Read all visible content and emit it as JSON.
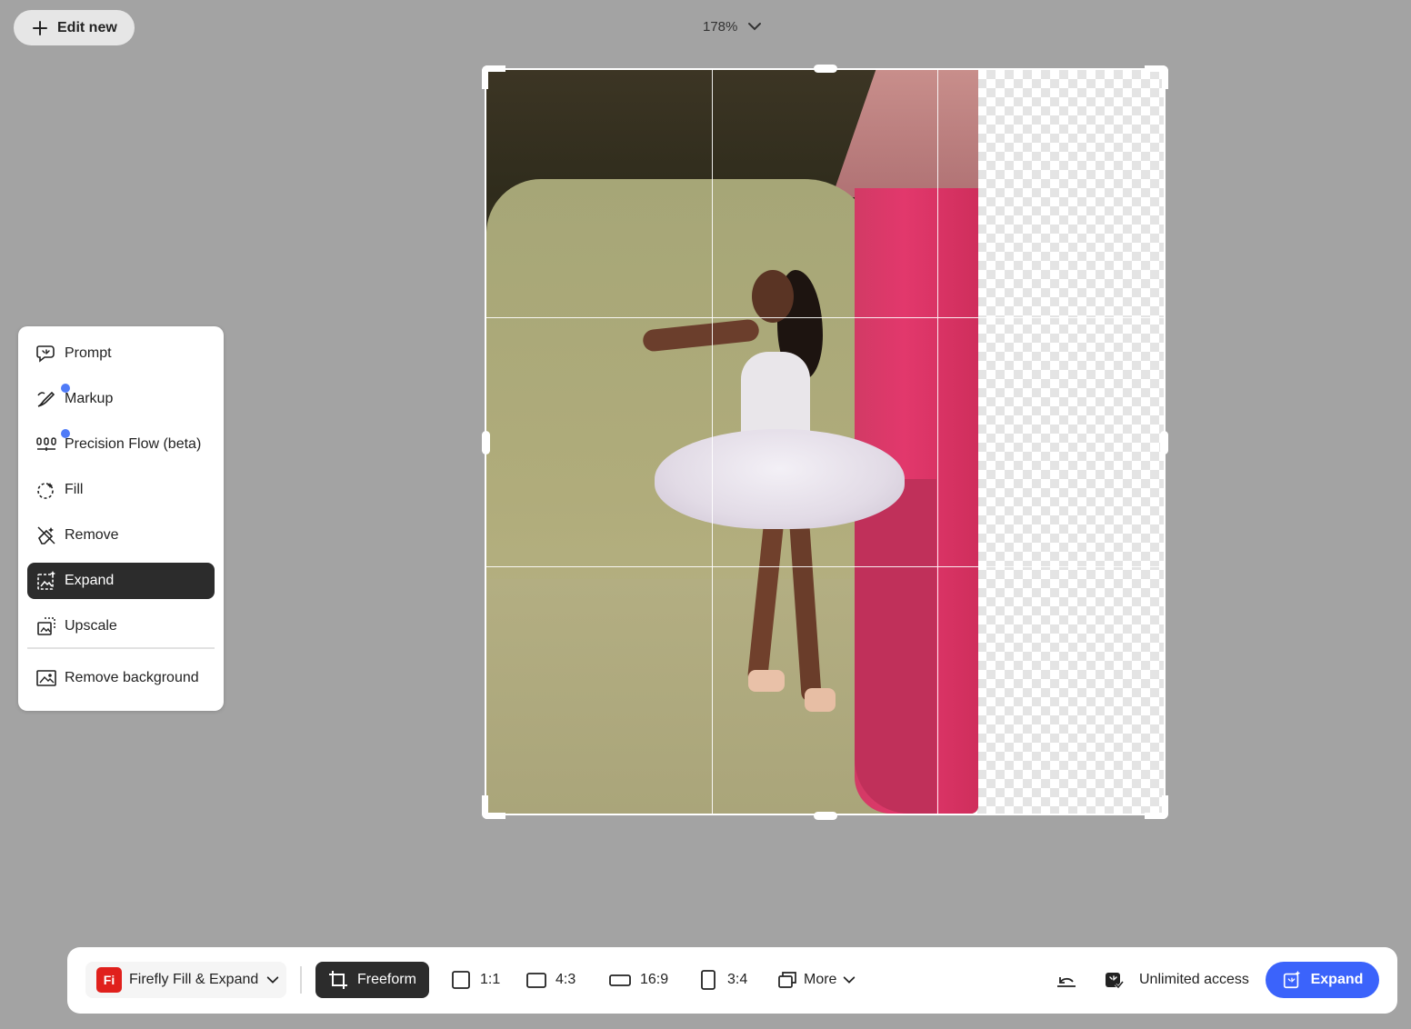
{
  "header": {
    "edit_new_label": "Edit new",
    "zoom_label": "178%"
  },
  "tools_menu": {
    "items": [
      {
        "label": "Prompt",
        "icon": "prompt-icon"
      },
      {
        "label": "Markup",
        "icon": "markup-icon",
        "badge": true
      },
      {
        "label": "Precision Flow (beta)",
        "icon": "precision-flow-icon",
        "badge": true
      },
      {
        "label": "Fill",
        "icon": "fill-icon"
      },
      {
        "label": "Remove",
        "icon": "remove-icon"
      },
      {
        "label": "Expand",
        "icon": "expand-icon",
        "active": true
      },
      {
        "label": "Upscale",
        "icon": "upscale-icon"
      },
      {
        "label": "Remove background",
        "icon": "remove-background-icon"
      }
    ]
  },
  "toolbar": {
    "app_name": "Firefly Fill & Expand",
    "app_logo": "Fi",
    "aspect_options": [
      {
        "label": "Freeform",
        "selected": true
      },
      {
        "label": "1:1"
      },
      {
        "label": "4:3"
      },
      {
        "label": "16:9"
      },
      {
        "label": "3:4"
      }
    ],
    "more_label": "More",
    "status_text": "Unlimited access",
    "expand_label": "Expand"
  },
  "colors": {
    "accent": "#3b63fb",
    "active_bg": "#2c2c2c",
    "badge_dot": "#4f7bf7",
    "logo_red": "#e0201c",
    "workspace_bg": "#a3a3a3"
  }
}
